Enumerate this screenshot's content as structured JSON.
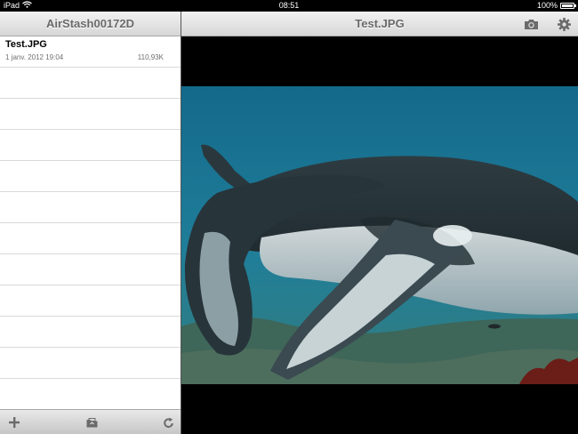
{
  "status_bar": {
    "device": "iPad",
    "time": "08:51",
    "battery": "100%",
    "battery_level": 1.0,
    "icons": [
      "wifi-icon",
      "battery-icon"
    ]
  },
  "master": {
    "title": "AirStash00172D",
    "files": [
      {
        "name": "Test.JPG",
        "date": "1 janv. 2012 19:04",
        "size": "110,93K"
      }
    ],
    "toolbar": {
      "icons": [
        "add-icon",
        "folder-icon",
        "refresh-icon"
      ]
    }
  },
  "detail": {
    "title": "Test.JPG",
    "icons": [
      "camera-icon",
      "gear-icon"
    ],
    "image": {
      "description_icon": "photo-preview"
    }
  },
  "colors": {
    "nav_text": "#6a6a6a",
    "water": "#1f6e8c",
    "background": "#000000"
  }
}
